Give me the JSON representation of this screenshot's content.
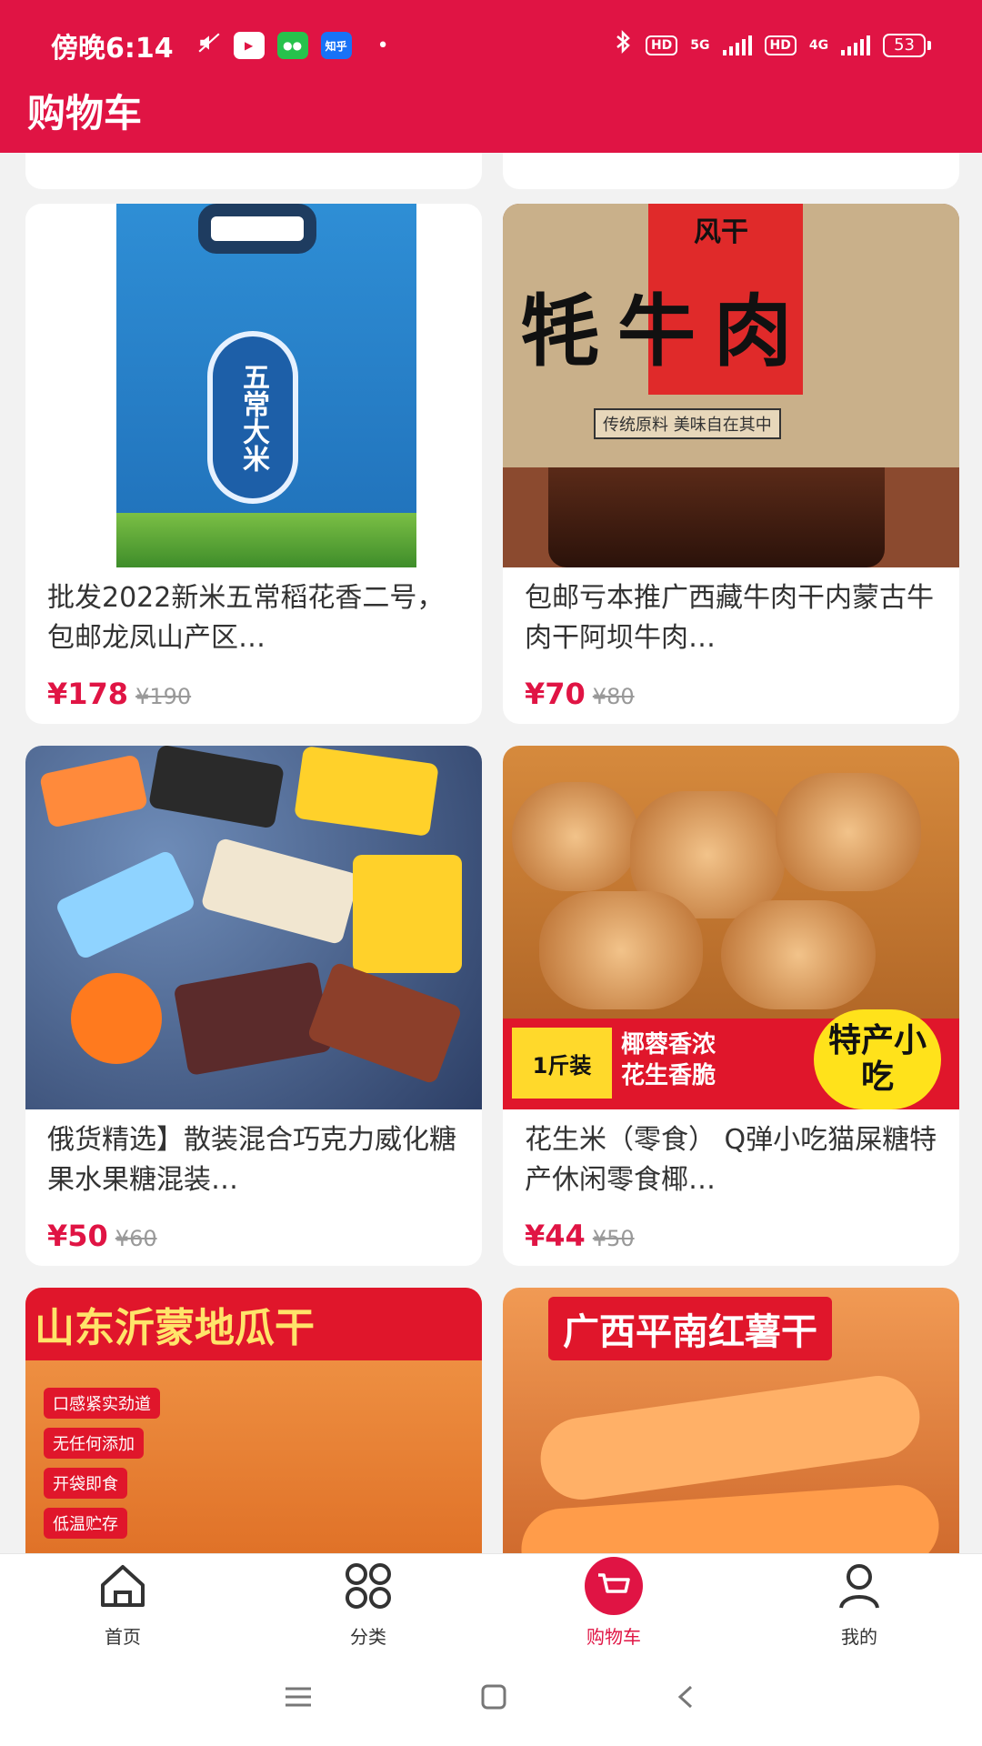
{
  "status_bar": {
    "time": "傍晚6:14",
    "apps": [
      "play-icon",
      "wechat-icon",
      "zhihu-icon"
    ],
    "zhihu_label": "知乎",
    "hd1": "HD",
    "net1": "5G",
    "hd2": "HD",
    "net2": "4G",
    "battery": "53"
  },
  "header": {
    "title": "购物车"
  },
  "products": [
    {
      "title": "批发2022新米五常稻花香二号，包邮龙凤山产区…",
      "price": "¥178",
      "old_price": "¥190",
      "art": {
        "brand": "五常大米"
      }
    },
    {
      "title": "包邮亏本推广西藏牛肉干内蒙古牛肉干阿坝牛肉…",
      "price": "¥70",
      "old_price": "¥80",
      "art": {
        "small_top": "风干",
        "big": "牦牛肉",
        "slogan": "传统原料 美味自在其中"
      }
    },
    {
      "title": "俄货精选】散装混合巧克力威化糖果水果糖混装…",
      "price": "¥50",
      "old_price": "¥60"
    },
    {
      "title": "花生米（零食） Q弹小吃猫屎糖特产休闲零食椰…",
      "price": "¥44",
      "old_price": "¥50",
      "art": {
        "amount": "1斤装",
        "line1": "椰蓉香浓",
        "line2": "花生香脆",
        "badge": "特产小吃"
      }
    },
    {
      "art": {
        "banner": "山东沂蒙地瓜干",
        "tags": [
          "口感紧实劲道",
          "无任何添加",
          "开袋即食",
          "低温贮存"
        ]
      }
    },
    {
      "art": {
        "banner": "广西平南红薯干"
      }
    }
  ],
  "bottom_nav": [
    {
      "label": "首页",
      "icon": "home-icon"
    },
    {
      "label": "分类",
      "icon": "grid-icon"
    },
    {
      "label": "购物车",
      "icon": "cart-icon",
      "active": true
    },
    {
      "label": "我的",
      "icon": "user-icon"
    }
  ],
  "colors": {
    "primary": "#e01444",
    "muted": "#999999",
    "text": "#333333"
  }
}
